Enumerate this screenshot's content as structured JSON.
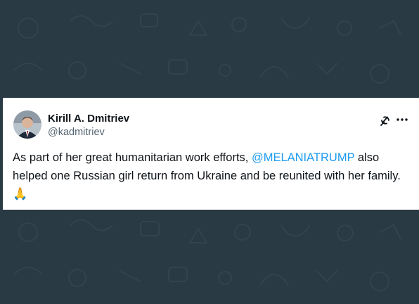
{
  "colors": {
    "background": "#2a3a45",
    "card": "#ffffff",
    "text": "#0f1419",
    "secondary": "#536471",
    "mention": "#1d9bf0"
  },
  "tweet": {
    "author_name": "Kirill A. Dmitriev",
    "author_handle": "@kadmitriev",
    "text_before": "As part of her great humanitarian work efforts, ",
    "mention": "@MELANIATRUMP",
    "text_after": " also helped one Russian girl return from Ukraine and be reunited with her family. ",
    "emoji": "🙏"
  },
  "icons": {
    "grok": "grok-icon",
    "more": "more-icon",
    "avatar": "avatar"
  }
}
